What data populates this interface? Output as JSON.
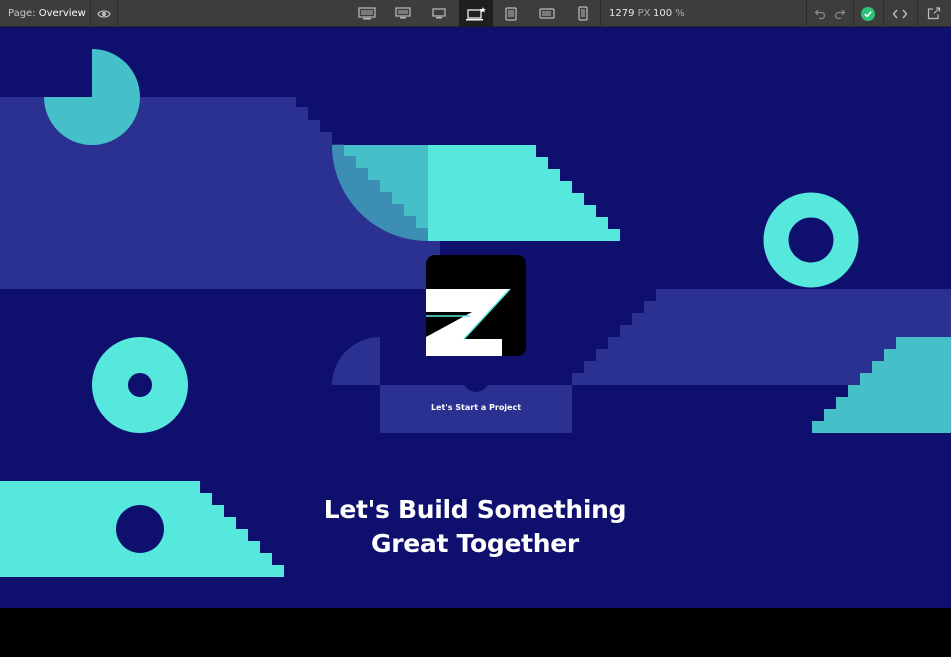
{
  "toolbar": {
    "page_prefix": "Page:",
    "page_name": "Overview",
    "width_value": "1279",
    "width_unit": "PX",
    "zoom_value": "100",
    "zoom_unit": "%",
    "icons": {
      "preview": "eye-icon",
      "breakpoints": [
        "desktop-xl-icon",
        "desktop-large-icon",
        "desktop-icon",
        "laptop-base-icon",
        "tablet-icon",
        "mobile-landscape-icon",
        "mobile-portrait-icon"
      ],
      "undo": "undo-icon",
      "redo": "redo-icon",
      "status": "check-circle-icon",
      "code": "code-icon",
      "export": "export-icon"
    },
    "active_breakpoint": "laptop-base-icon"
  },
  "canvas": {
    "cta_label": "Let's Start a Project",
    "headline_line1": "Let's Build Something",
    "headline_line2": "Great Together",
    "colors": {
      "background": "#0f0f6e",
      "panel": "#2a3190",
      "accent": "#56e8dc",
      "accent_dim": "#46c0c8",
      "logo_bg": "#000000",
      "logo_mark": "#ffffff"
    }
  }
}
